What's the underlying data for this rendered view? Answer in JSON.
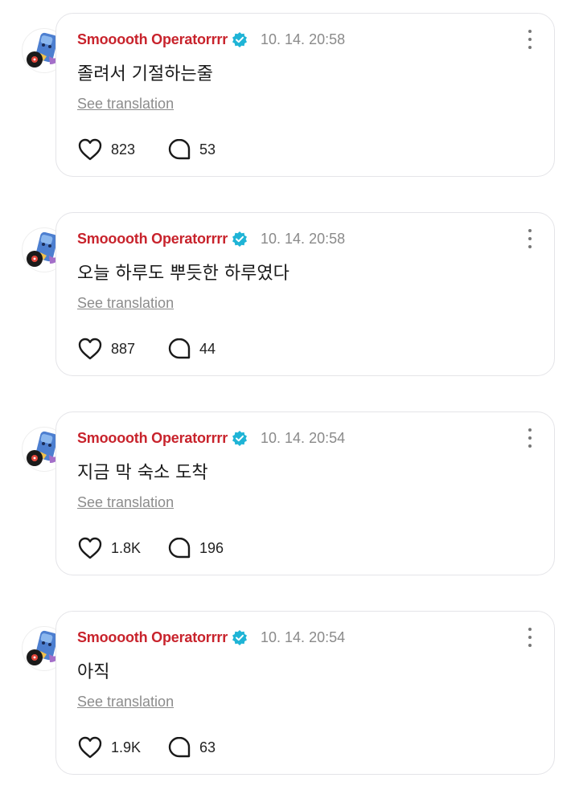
{
  "colors": {
    "username": "#c8232c",
    "verified_badge": "#1fb4d6",
    "timestamp": "#8a8a8a",
    "card_border": "#e4e4e8"
  },
  "posts": [
    {
      "username": "Smooooth Operatorrrr",
      "timestamp": "10. 14. 20:58",
      "content": "졸려서 기절하는줄",
      "translate_label": "See translation",
      "likes": "823",
      "comments": "53"
    },
    {
      "username": "Smooooth Operatorrrr",
      "timestamp": "10. 14. 20:58",
      "content": "오늘 하루도 뿌듯한 하루였다",
      "translate_label": "See translation",
      "likes": "887",
      "comments": "44"
    },
    {
      "username": "Smooooth Operatorrrr",
      "timestamp": "10. 14. 20:54",
      "content": "지금 막 숙소 도착",
      "translate_label": "See translation",
      "likes": "1.8K",
      "comments": "196"
    },
    {
      "username": "Smooooth Operatorrrr",
      "timestamp": "10. 14. 20:54",
      "content": "아직",
      "translate_label": "See translation",
      "likes": "1.9K",
      "comments": "63"
    }
  ],
  "icons": {
    "avatar": "character-avatar",
    "verified": "verified-badge-icon",
    "more": "more-vertical-icon",
    "like": "heart-icon",
    "comment": "comment-bubble-icon"
  }
}
